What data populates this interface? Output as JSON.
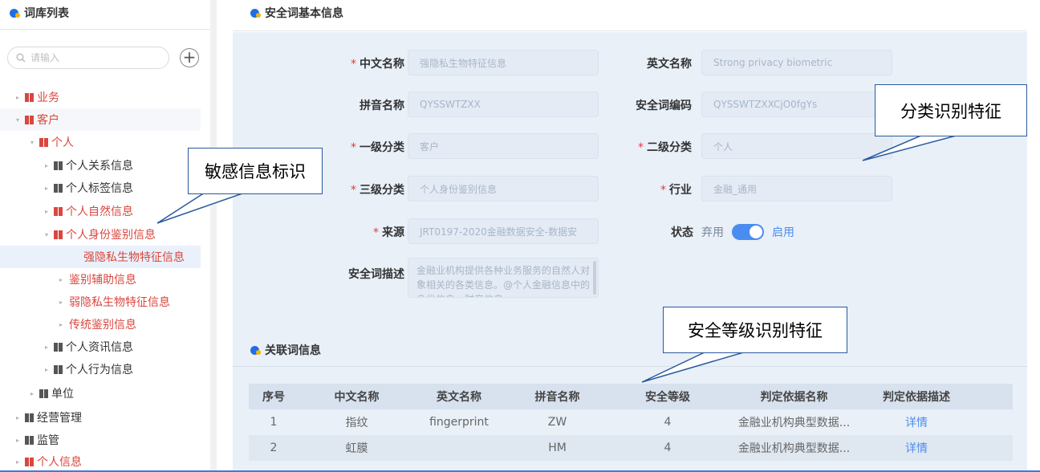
{
  "left_panel": {
    "title": "词库列表",
    "search_placeholder": "请输入",
    "add_symbol": "+"
  },
  "tree": [
    {
      "label": "业务",
      "color": "red",
      "caret": "▸"
    },
    {
      "label": "客户",
      "color": "red",
      "caret": "▾"
    },
    {
      "label": "个人",
      "color": "red",
      "caret": "▾"
    },
    {
      "label": "个人关系信息",
      "color": "dark",
      "caret": "▸"
    },
    {
      "label": "个人标签信息",
      "color": "dark",
      "caret": "▸"
    },
    {
      "label": "个人自然信息",
      "color": "red",
      "caret": "▸"
    },
    {
      "label": "个人身份鉴别信息",
      "color": "red",
      "caret": "▾"
    },
    {
      "label": "强隐私生物特征信息",
      "color": "red",
      "caret": ""
    },
    {
      "label": "鉴别辅助信息",
      "color": "red",
      "caret": "▸"
    },
    {
      "label": "弱隐私生物特征信息",
      "color": "red",
      "caret": "▸"
    },
    {
      "label": "传统鉴别信息",
      "color": "red",
      "caret": "▸"
    },
    {
      "label": "个人资讯信息",
      "color": "dark",
      "caret": "▸"
    },
    {
      "label": "个人行为信息",
      "color": "dark",
      "caret": "▸"
    },
    {
      "label": "单位",
      "color": "dark",
      "caret": "▸"
    },
    {
      "label": "经营管理",
      "color": "dark",
      "caret": "▸"
    },
    {
      "label": "监管",
      "color": "dark",
      "caret": "▸"
    },
    {
      "label": "个人信息",
      "color": "red",
      "caret": "▸"
    }
  ],
  "detail": {
    "title": "安全词基本信息",
    "required_mark": "*",
    "fields": {
      "cn_name": {
        "label": "中文名称",
        "value": "强隐私生物特征信息"
      },
      "en_name": {
        "label": "英文名称",
        "value": "Strong privacy biometric"
      },
      "pinyin": {
        "label": "拼音名称",
        "value": "QYSSWTZXX"
      },
      "code": {
        "label": "安全词编码",
        "value": "QYSSWTZXXCjO0fgYs"
      },
      "level1": {
        "label": "一级分类",
        "value": "客户"
      },
      "level2": {
        "label": "二级分类",
        "value": "个人"
      },
      "level3": {
        "label": "三级分类",
        "value": "个人身份鉴别信息"
      },
      "industry": {
        "label": "行业",
        "value": "金融_通用"
      },
      "source": {
        "label": "来源",
        "value": "JRT0197-2020金融数据安全-数据安"
      },
      "description": {
        "label": "安全词描述",
        "value": "金融业机构提供各种业务服务的自然人对象相关的各类信息。@个人金融信息中的身份信息、财产信息"
      }
    },
    "status": {
      "label": "状态",
      "off": "弃用",
      "on": "启用",
      "enabled": true
    }
  },
  "related": {
    "title": "关联词信息",
    "columns": [
      "序号",
      "中文名称",
      "英文名称",
      "拼音名称",
      "安全等级",
      "判定依据名称",
      "判定依据描述"
    ],
    "rows": [
      {
        "index": "1",
        "cn": "指纹",
        "en": "fingerprint",
        "pinyin": "ZW",
        "level": "4",
        "basis": "金融业机构典型数据...",
        "desc": "详情"
      },
      {
        "index": "2",
        "cn": "虹膜",
        "en": "",
        "pinyin": "HM",
        "level": "4",
        "basis": "金融业机构典型数据...",
        "desc": "详情"
      }
    ]
  },
  "callouts": {
    "sensitive": "敏感信息标识",
    "category": "分类识别特征",
    "security_level": "安全等级识别特征"
  },
  "colors": {
    "accent": "#4a8df0",
    "red_text": "#d9473f",
    "form_bg": "#e9f0f8"
  }
}
